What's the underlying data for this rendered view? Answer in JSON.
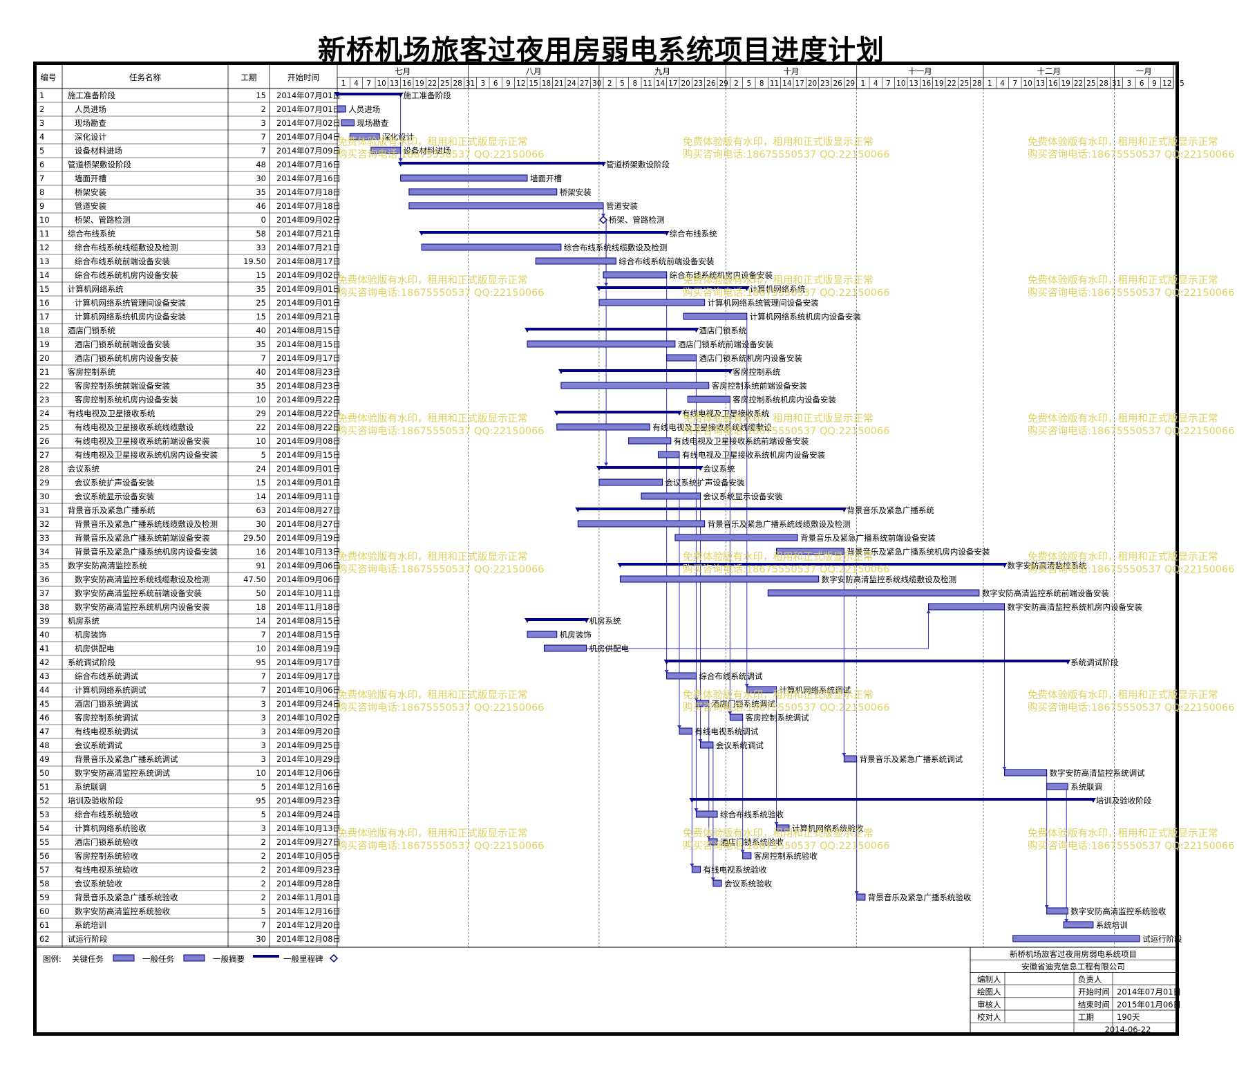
{
  "title": "新桥机场旅客过夜用房弱电系统项目进度计划",
  "headers": {
    "id": "编号",
    "name": "任务名称",
    "duration": "工期",
    "start": "开始时间"
  },
  "timeline": {
    "months": [
      {
        "label": "七月",
        "days": [
          "1",
          "4",
          "7",
          "10",
          "13",
          "16",
          "19",
          "22",
          "25",
          "28",
          "31"
        ]
      },
      {
        "label": "八月",
        "days": [
          "3",
          "6",
          "9",
          "12",
          "15",
          "18",
          "21",
          "24",
          "27",
          "30"
        ]
      },
      {
        "label": "九月",
        "days": [
          "2",
          "5",
          "8",
          "11",
          "14",
          "17",
          "20",
          "23",
          "26",
          "29"
        ]
      },
      {
        "label": "十月",
        "days": [
          "2",
          "5",
          "8",
          "11",
          "14",
          "17",
          "20",
          "23",
          "26",
          "29"
        ]
      },
      {
        "label": "十一月",
        "days": [
          "1",
          "4",
          "7",
          "10",
          "13",
          "16",
          "19",
          "22",
          "25",
          "28"
        ]
      },
      {
        "label": "十二月",
        "days": [
          "1",
          "4",
          "7",
          "10",
          "13",
          "16",
          "19",
          "22",
          "25",
          "28",
          "31"
        ]
      },
      {
        "label": "一月",
        "days": [
          "3",
          "6",
          "9",
          "12",
          "15"
        ]
      }
    ]
  },
  "watermark": {
    "line1": "免费体验版有水印，租用和正式版显示正常",
    "line2": "购买咨询电话:18675550537 QQ:22150066"
  },
  "legend": {
    "prefix": "图例:",
    "items": [
      "关键任务",
      "一般任务",
      "一般摘要",
      "一般里程碑"
    ]
  },
  "colors": {
    "bar": "#8080d0",
    "bar_border": "#000080",
    "summary": "#000080",
    "watermark": "#e0d060",
    "link": "#3030c0"
  },
  "info": {
    "project": "新桥机场旅客过夜用房弱电系统项目",
    "company": "安徽省迪克信息工程有限公司",
    "rows": [
      {
        "l1": "编制人",
        "v1": "",
        "l2": "负责人",
        "v2": ""
      },
      {
        "l1": "绘图人",
        "v1": "",
        "l2": "开始时间",
        "v2": "2014年07月01日"
      },
      {
        "l1": "审核人",
        "v1": "",
        "l2": "结束时间",
        "v2": "2015年01月06日"
      },
      {
        "l1": "校对人",
        "v1": "",
        "l2": "工期",
        "v2": "190天"
      }
    ],
    "date": "2014-06-22"
  },
  "chart_data": {
    "type": "gantt",
    "x_unit": "date",
    "x_range": [
      "2014-07-01",
      "2015-01-16"
    ],
    "tasks": [
      {
        "id": "1",
        "name": "施工准备阶段",
        "dur": "15",
        "start": "2014年07月01日",
        "kind": "summary",
        "s": "2014-07-01",
        "e": "2014-07-15",
        "level": 0
      },
      {
        "id": "2",
        "name": "人员进场",
        "dur": "2",
        "start": "2014年07月01日",
        "kind": "task",
        "s": "2014-07-01",
        "e": "2014-07-02",
        "level": 1
      },
      {
        "id": "3",
        "name": "现场勘查",
        "dur": "3",
        "start": "2014年07月02日",
        "kind": "task",
        "s": "2014-07-02",
        "e": "2014-07-04",
        "level": 1
      },
      {
        "id": "4",
        "name": "深化设计",
        "dur": "7",
        "start": "2014年07月04日",
        "kind": "task",
        "s": "2014-07-04",
        "e": "2014-07-10",
        "level": 1
      },
      {
        "id": "5",
        "name": "设备材料进场",
        "dur": "7",
        "start": "2014年07月09日",
        "kind": "task",
        "s": "2014-07-09",
        "e": "2014-07-15",
        "level": 1
      },
      {
        "id": "6",
        "name": "管道桥架敷设阶段",
        "dur": "48",
        "start": "2014年07月16日",
        "kind": "summary",
        "s": "2014-07-16",
        "e": "2014-09-01",
        "level": 0
      },
      {
        "id": "7",
        "name": "墙面开槽",
        "dur": "30",
        "start": "2014年07月16日",
        "kind": "task",
        "s": "2014-07-16",
        "e": "2014-08-14",
        "level": 1
      },
      {
        "id": "8",
        "name": "桥架安装",
        "dur": "35",
        "start": "2014年07月18日",
        "kind": "task",
        "s": "2014-07-18",
        "e": "2014-08-21",
        "level": 1
      },
      {
        "id": "9",
        "name": "管道安装",
        "dur": "46",
        "start": "2014年07月18日",
        "kind": "task",
        "s": "2014-07-18",
        "e": "2014-09-01",
        "level": 1
      },
      {
        "id": "10",
        "name": "桥架、管路检测",
        "dur": "0",
        "start": "2014年09月02日",
        "kind": "milestone",
        "s": "2014-09-02",
        "e": "2014-09-02",
        "level": 1
      },
      {
        "id": "11",
        "name": "综合布线系统",
        "dur": "58",
        "start": "2014年07月21日",
        "kind": "summary",
        "s": "2014-07-21",
        "e": "2014-09-16",
        "level": 0
      },
      {
        "id": "12",
        "name": "综合布线系统线缆敷设及检测",
        "dur": "33",
        "start": "2014年07月21日",
        "kind": "task",
        "s": "2014-07-21",
        "e": "2014-08-22",
        "level": 1
      },
      {
        "id": "13",
        "name": "综合布线系统前端设备安装",
        "dur": "19.50",
        "start": "2014年08月17日",
        "kind": "task",
        "s": "2014-08-17",
        "e": "2014-09-04",
        "level": 1
      },
      {
        "id": "14",
        "name": "综合布线系统机房内设备安装",
        "dur": "15",
        "start": "2014年09月02日",
        "kind": "task",
        "s": "2014-09-02",
        "e": "2014-09-16",
        "level": 1
      },
      {
        "id": "15",
        "name": "计算机网络系统",
        "dur": "35",
        "start": "2014年09月01日",
        "kind": "summary",
        "s": "2014-09-01",
        "e": "2014-10-05",
        "level": 0
      },
      {
        "id": "16",
        "name": "计算机网络系统管理间设备安装",
        "dur": "25",
        "start": "2014年09月01日",
        "kind": "task",
        "s": "2014-09-01",
        "e": "2014-09-25",
        "level": 1
      },
      {
        "id": "17",
        "name": "计算机网络系统机房内设备安装",
        "dur": "15",
        "start": "2014年09月21日",
        "kind": "task",
        "s": "2014-09-21",
        "e": "2014-10-05",
        "level": 1
      },
      {
        "id": "18",
        "name": "酒店门锁系统",
        "dur": "40",
        "start": "2014年08月15日",
        "kind": "summary",
        "s": "2014-08-15",
        "e": "2014-09-23",
        "level": 0
      },
      {
        "id": "19",
        "name": "酒店门锁系统前端设备安装",
        "dur": "35",
        "start": "2014年08月15日",
        "kind": "task",
        "s": "2014-08-15",
        "e": "2014-09-18",
        "level": 1
      },
      {
        "id": "20",
        "name": "酒店门锁系统机房内设备安装",
        "dur": "7",
        "start": "2014年09月17日",
        "kind": "task",
        "s": "2014-09-17",
        "e": "2014-09-23",
        "level": 1
      },
      {
        "id": "21",
        "name": "客房控制系统",
        "dur": "40",
        "start": "2014年08月23日",
        "kind": "summary",
        "s": "2014-08-23",
        "e": "2014-10-01",
        "level": 0
      },
      {
        "id": "22",
        "name": "客房控制系统前端设备安装",
        "dur": "35",
        "start": "2014年08月23日",
        "kind": "task",
        "s": "2014-08-23",
        "e": "2014-09-26",
        "level": 1
      },
      {
        "id": "23",
        "name": "客房控制系统机房内设备安装",
        "dur": "10",
        "start": "2014年09月22日",
        "kind": "task",
        "s": "2014-09-22",
        "e": "2014-10-01",
        "level": 1
      },
      {
        "id": "24",
        "name": "有线电视及卫星接收系统",
        "dur": "29",
        "start": "2014年08月22日",
        "kind": "summary",
        "s": "2014-08-22",
        "e": "2014-09-19",
        "level": 0
      },
      {
        "id": "25",
        "name": "有线电视及卫星接收系统线缆敷设",
        "dur": "22",
        "start": "2014年08月22日",
        "kind": "task",
        "s": "2014-08-22",
        "e": "2014-09-12",
        "level": 1
      },
      {
        "id": "26",
        "name": "有线电视及卫星接收系统前端设备安装",
        "dur": "10",
        "start": "2014年09月08日",
        "kind": "task",
        "s": "2014-09-08",
        "e": "2014-09-17",
        "level": 1
      },
      {
        "id": "27",
        "name": "有线电视及卫星接收系统机房内设备安装",
        "dur": "5",
        "start": "2014年09月15日",
        "kind": "task",
        "s": "2014-09-15",
        "e": "2014-09-19",
        "level": 1
      },
      {
        "id": "28",
        "name": "会议系统",
        "dur": "24",
        "start": "2014年09月01日",
        "kind": "summary",
        "s": "2014-09-01",
        "e": "2014-09-24",
        "level": 0
      },
      {
        "id": "29",
        "name": "会议系统扩声设备安装",
        "dur": "15",
        "start": "2014年09月01日",
        "kind": "task",
        "s": "2014-09-01",
        "e": "2014-09-15",
        "level": 1
      },
      {
        "id": "30",
        "name": "会议系统显示设备安装",
        "dur": "14",
        "start": "2014年09月11日",
        "kind": "task",
        "s": "2014-09-11",
        "e": "2014-09-24",
        "level": 1
      },
      {
        "id": "31",
        "name": "背景音乐及紧急广播系统",
        "dur": "63",
        "start": "2014年08月27日",
        "kind": "summary",
        "s": "2014-08-27",
        "e": "2014-10-28",
        "level": 0
      },
      {
        "id": "32",
        "name": "背景音乐及紧急广播系统线缆敷设及检测",
        "dur": "30",
        "start": "2014年08月27日",
        "kind": "task",
        "s": "2014-08-27",
        "e": "2014-09-25",
        "level": 1
      },
      {
        "id": "33",
        "name": "背景音乐及紧急广播系统前端设备安装",
        "dur": "29.50",
        "start": "2014年09月19日",
        "kind": "task",
        "s": "2014-09-19",
        "e": "2014-10-17",
        "level": 1
      },
      {
        "id": "34",
        "name": "背景音乐及紧急广播系统机房内设备安装",
        "dur": "16",
        "start": "2014年10月13日",
        "kind": "task",
        "s": "2014-10-13",
        "e": "2014-10-28",
        "level": 1
      },
      {
        "id": "35",
        "name": "数字安防高清监控系统",
        "dur": "91",
        "start": "2014年09月06日",
        "kind": "summary",
        "s": "2014-09-06",
        "e": "2014-12-05",
        "level": 0
      },
      {
        "id": "36",
        "name": "数字安防高清监控系统线缆敷设及检测",
        "dur": "47.50",
        "start": "2014年09月06日",
        "kind": "task",
        "s": "2014-09-06",
        "e": "2014-10-22",
        "level": 1
      },
      {
        "id": "37",
        "name": "数字安防高清监控系统前端设备安装",
        "dur": "50",
        "start": "2014年10月11日",
        "kind": "task",
        "s": "2014-10-11",
        "e": "2014-11-29",
        "level": 1
      },
      {
        "id": "38",
        "name": "数字安防高清监控系统机房内设备安装",
        "dur": "18",
        "start": "2014年11月18日",
        "kind": "task",
        "s": "2014-11-18",
        "e": "2014-12-05",
        "level": 1
      },
      {
        "id": "39",
        "name": "机房系统",
        "dur": "14",
        "start": "2014年08月15日",
        "kind": "summary",
        "s": "2014-08-15",
        "e": "2014-08-28",
        "level": 0
      },
      {
        "id": "40",
        "name": "机房装饰",
        "dur": "7",
        "start": "2014年08月15日",
        "kind": "task",
        "s": "2014-08-15",
        "e": "2014-08-21",
        "level": 1
      },
      {
        "id": "41",
        "name": "机房供配电",
        "dur": "10",
        "start": "2014年08月19日",
        "kind": "task",
        "s": "2014-08-19",
        "e": "2014-08-28",
        "level": 1
      },
      {
        "id": "42",
        "name": "系统调试阶段",
        "dur": "95",
        "start": "2014年09月17日",
        "kind": "summary",
        "s": "2014-09-17",
        "e": "2014-12-20",
        "level": 0
      },
      {
        "id": "43",
        "name": "综合布线系统调试",
        "dur": "7",
        "start": "2014年09月17日",
        "kind": "task",
        "s": "2014-09-17",
        "e": "2014-09-23",
        "level": 1
      },
      {
        "id": "44",
        "name": "计算机网络系统调试",
        "dur": "7",
        "start": "2014年10月06日",
        "kind": "task",
        "s": "2014-10-06",
        "e": "2014-10-12",
        "level": 1
      },
      {
        "id": "45",
        "name": "酒店门锁系统调试",
        "dur": "3",
        "start": "2014年09月24日",
        "kind": "task",
        "s": "2014-09-24",
        "e": "2014-09-26",
        "level": 1
      },
      {
        "id": "46",
        "name": "客房控制系统调试",
        "dur": "3",
        "start": "2014年10月02日",
        "kind": "task",
        "s": "2014-10-02",
        "e": "2014-10-04",
        "level": 1
      },
      {
        "id": "47",
        "name": "有线电视系统调试",
        "dur": "3",
        "start": "2014年09月20日",
        "kind": "task",
        "s": "2014-09-20",
        "e": "2014-09-22",
        "level": 1
      },
      {
        "id": "48",
        "name": "会议系统调试",
        "dur": "3",
        "start": "2014年09月25日",
        "kind": "task",
        "s": "2014-09-25",
        "e": "2014-09-27",
        "level": 1
      },
      {
        "id": "49",
        "name": "背景音乐及紧急广播系统调试",
        "dur": "3",
        "start": "2014年10月29日",
        "kind": "task",
        "s": "2014-10-29",
        "e": "2014-10-31",
        "level": 1
      },
      {
        "id": "50",
        "name": "数字安防高清监控系统调试",
        "dur": "10",
        "start": "2014年12月06日",
        "kind": "task",
        "s": "2014-12-06",
        "e": "2014-12-15",
        "level": 1
      },
      {
        "id": "51",
        "name": "系统联调",
        "dur": "5",
        "start": "2014年12月16日",
        "kind": "task",
        "s": "2014-12-16",
        "e": "2014-12-20",
        "level": 1
      },
      {
        "id": "52",
        "name": "培训及验收阶段",
        "dur": "95",
        "start": "2014年09月23日",
        "kind": "summary",
        "s": "2014-09-23",
        "e": "2014-12-26",
        "level": 0
      },
      {
        "id": "53",
        "name": "综合布线系统验收",
        "dur": "5",
        "start": "2014年09月24日",
        "kind": "task",
        "s": "2014-09-24",
        "e": "2014-09-28",
        "level": 1
      },
      {
        "id": "54",
        "name": "计算机网络系统验收",
        "dur": "3",
        "start": "2014年10月13日",
        "kind": "task",
        "s": "2014-10-13",
        "e": "2014-10-15",
        "level": 1
      },
      {
        "id": "55",
        "name": "酒店门锁系统验收",
        "dur": "2",
        "start": "2014年09月27日",
        "kind": "task",
        "s": "2014-09-27",
        "e": "2014-09-28",
        "level": 1
      },
      {
        "id": "56",
        "name": "客房控制系统验收",
        "dur": "2",
        "start": "2014年10月05日",
        "kind": "task",
        "s": "2014-10-05",
        "e": "2014-10-06",
        "level": 1
      },
      {
        "id": "57",
        "name": "有线电视系统验收",
        "dur": "2",
        "start": "2014年09月23日",
        "kind": "task",
        "s": "2014-09-23",
        "e": "2014-09-24",
        "level": 1
      },
      {
        "id": "58",
        "name": "会议系统验收",
        "dur": "2",
        "start": "2014年09月28日",
        "kind": "task",
        "s": "2014-09-28",
        "e": "2014-09-29",
        "level": 1
      },
      {
        "id": "59",
        "name": "背景音乐及紧急广播系统验收",
        "dur": "2",
        "start": "2014年11月01日",
        "kind": "task",
        "s": "2014-11-01",
        "e": "2014-11-02",
        "level": 1
      },
      {
        "id": "60",
        "name": "数字安防高清监控系统验收",
        "dur": "5",
        "start": "2014年12月16日",
        "kind": "task",
        "s": "2014-12-16",
        "e": "2014-12-20",
        "level": 1
      },
      {
        "id": "61",
        "name": "系统培训",
        "dur": "7",
        "start": "2014年12月20日",
        "kind": "task",
        "s": "2014-12-20",
        "e": "2014-12-26",
        "level": 1
      },
      {
        "id": "62",
        "name": "试运行阶段",
        "dur": "30",
        "start": "2014年12月08日",
        "kind": "task",
        "s": "2014-12-08",
        "e": "2015-01-06",
        "level": 0
      }
    ],
    "links": [
      [
        "1",
        "6"
      ],
      [
        "9",
        "10"
      ],
      [
        "10",
        "15"
      ],
      [
        "10",
        "28"
      ],
      [
        "14",
        "43"
      ],
      [
        "17",
        "44"
      ],
      [
        "20",
        "45"
      ],
      [
        "23",
        "46"
      ],
      [
        "27",
        "47"
      ],
      [
        "30",
        "48"
      ],
      [
        "34",
        "49"
      ],
      [
        "38",
        "50"
      ],
      [
        "41",
        "38"
      ],
      [
        "43",
        "53"
      ],
      [
        "44",
        "54"
      ],
      [
        "45",
        "55"
      ],
      [
        "46",
        "56"
      ],
      [
        "47",
        "57"
      ],
      [
        "48",
        "58"
      ],
      [
        "49",
        "59"
      ],
      [
        "50",
        "60"
      ],
      [
        "51",
        "61"
      ]
    ]
  }
}
